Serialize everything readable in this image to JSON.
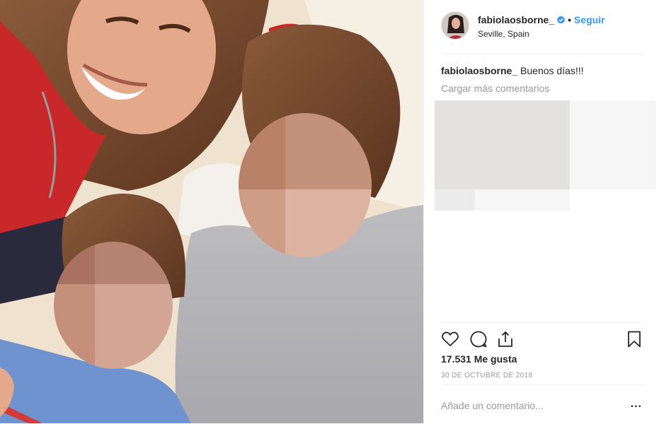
{
  "post": {
    "username": "fabiolaosborne_",
    "separator": "•",
    "follow_label": "Seguir",
    "location": "Seville, Spain",
    "caption_user": "fabiolaosborne_",
    "caption_text": "Buenos días!!!",
    "load_more": "Cargar más comentarios",
    "likes": "17.531 Me gusta",
    "date": "30 DE OCTUBRE DE 2018",
    "comment_placeholder": "Añade un comentario...",
    "more_options": "..."
  },
  "colors": {
    "accent": "#3897f0",
    "text": "#262626",
    "muted": "#999999",
    "border": "#efefef"
  },
  "icons": [
    "verified-badge-icon",
    "heart-icon",
    "comment-icon",
    "share-icon",
    "bookmark-icon"
  ]
}
